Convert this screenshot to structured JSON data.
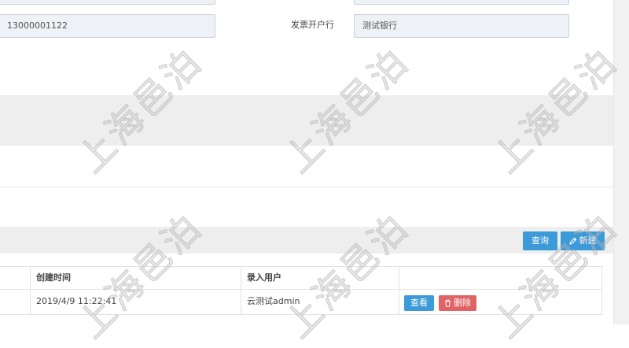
{
  "form": {
    "top_left_value": "",
    "top_right_value": "",
    "phone_value": "13000001122",
    "invoice_bank_label": "发票开户行",
    "invoice_bank_value": "测试银行"
  },
  "toolbar": {
    "query_label": "查询",
    "new_label": "新建"
  },
  "table": {
    "headers": [
      "创建时间",
      "录入用户"
    ],
    "rows": [
      {
        "created_at": "2019/4/9 11:22:41",
        "entered_by": "云测试admin",
        "view_label": "查看",
        "delete_label": "删除"
      }
    ]
  },
  "watermark": "上海邑泊",
  "icons": {
    "new": "pencil-icon",
    "delete": "trash-icon"
  },
  "colors": {
    "primary": "#3c9ad8",
    "danger": "#e06466",
    "input_bg": "#eef1f5"
  }
}
